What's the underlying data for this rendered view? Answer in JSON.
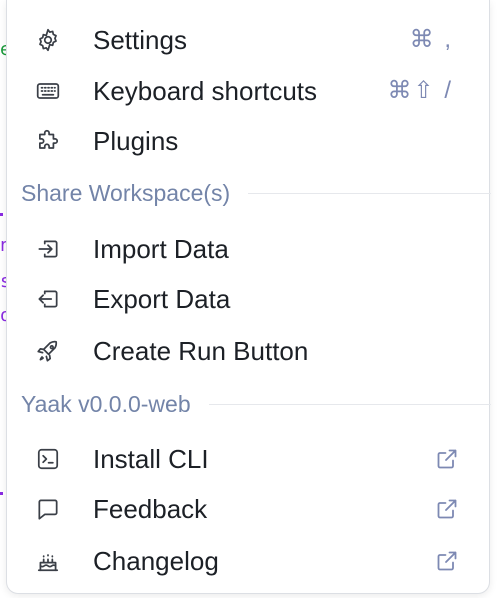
{
  "background": {
    "fragments": [
      {
        "text": "e",
        "color": "#1a9a3a"
      },
      {
        "text": "n",
        "color": "#8a2be2"
      },
      {
        "text": "s",
        "color": "#8a2be2"
      },
      {
        "text": "o",
        "color": "#8a2be2"
      }
    ]
  },
  "menu": {
    "items_top": [
      {
        "label": "Settings",
        "icon": "gear-icon",
        "hotkey": "⌘ ,"
      },
      {
        "label": "Keyboard shortcuts",
        "icon": "keyboard-icon",
        "hotkey": "⌘⇧ /"
      },
      {
        "label": "Plugins",
        "icon": "puzzle-icon",
        "hotkey": ""
      }
    ],
    "section_share": {
      "title": "Share Workspace(s)",
      "items": [
        {
          "label": "Import Data",
          "icon": "import-icon"
        },
        {
          "label": "Export Data",
          "icon": "export-icon"
        },
        {
          "label": "Create Run Button",
          "icon": "rocket-icon"
        }
      ]
    },
    "section_version": {
      "title": "Yaak v0.0.0-web",
      "items": [
        {
          "label": "Install CLI",
          "icon": "terminal-icon",
          "external": "external-link-icon"
        },
        {
          "label": "Feedback",
          "icon": "message-icon",
          "external": "external-link-icon"
        },
        {
          "label": "Changelog",
          "icon": "cake-icon",
          "external": "external-link-icon"
        }
      ]
    }
  },
  "colors": {
    "text": "#1c2026",
    "muted": "#7384a8",
    "hotkey": "#7d89b3",
    "border": "#dcdfe4"
  }
}
